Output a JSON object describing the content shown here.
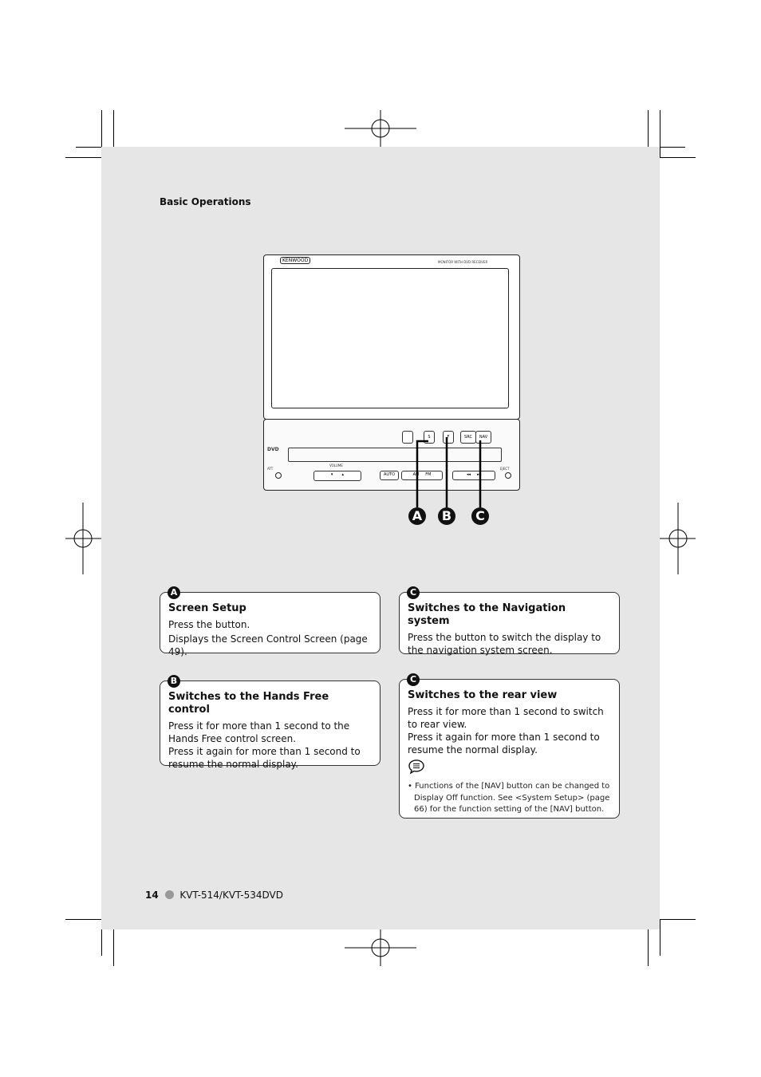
{
  "header": {
    "section": "Basic Operations"
  },
  "device": {
    "brand": "KENWOOD",
    "model_label": "MONITOR WITH DVD RECEIVER",
    "volume": "VOLUME",
    "auto": "AUTO",
    "att": "ATT",
    "eject": "EJECT",
    "src": "SRC",
    "nav": "NAV",
    "am": "AM",
    "fm": "FM",
    "dvd": "DVD"
  },
  "callouts": [
    "A",
    "B",
    "C"
  ],
  "boxes": [
    {
      "badge": "A",
      "title": "Screen Setup",
      "lines": [
        "Press the button.",
        "Displays the Screen Control Screen (page 49)."
      ]
    },
    {
      "badge": "C",
      "title": "Switches to the Navigation system",
      "lines": [
        "Press the button to switch the display to the navigation system screen."
      ]
    },
    {
      "badge": "B",
      "title": "Switches to the Hands Free control",
      "lines": [
        "Press it for more than 1 second to the Hands Free control screen.",
        "Press it again for more than 1 second to resume the normal display."
      ]
    },
    {
      "badge": "C",
      "title": "Switches to the rear view",
      "lines": [
        "Press it for more than 1 second to switch to rear view.",
        "Press it again for more than 1 second to resume the normal display."
      ],
      "note": "Functions of the [NAV] button can be changed to Display Off function. See <System Setup> (page 66) for the function setting of the [NAV] button."
    }
  ],
  "footer": {
    "page": "14",
    "model": "KVT-514/KVT-534DVD"
  }
}
